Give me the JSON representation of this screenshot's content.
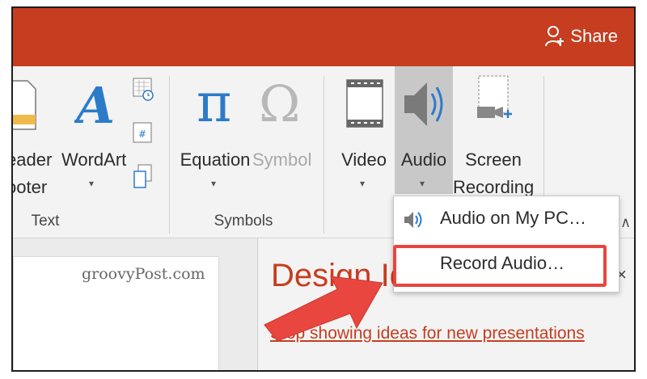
{
  "titlebar": {
    "share_label": "Share"
  },
  "ribbon": {
    "header_footer_lines": [
      "eader",
      "ooter"
    ],
    "wordart_label": "WordArt",
    "text_group_label": "Text",
    "equation_label": "Equation",
    "symbol_label": "Symbol",
    "symbols_group_label": "Symbols",
    "video_label": "Video",
    "audio_label": "Audio",
    "screen_recording_lines": [
      "Screen",
      "Recording"
    ],
    "caret": "▾",
    "collapse": "∧"
  },
  "audio_menu": {
    "items": [
      {
        "label": "Audio on My PC…"
      },
      {
        "label": "Record Audio…"
      }
    ]
  },
  "content": {
    "watermark": "groovyPost.com",
    "design_title": "Design Ideas",
    "close": "×",
    "stop_link": "Stop showing ideas for new presentations"
  },
  "colors": {
    "accent": "#c63d1f",
    "callout": "#e8463e",
    "audio_selected_bg": "#c8c8c8"
  }
}
